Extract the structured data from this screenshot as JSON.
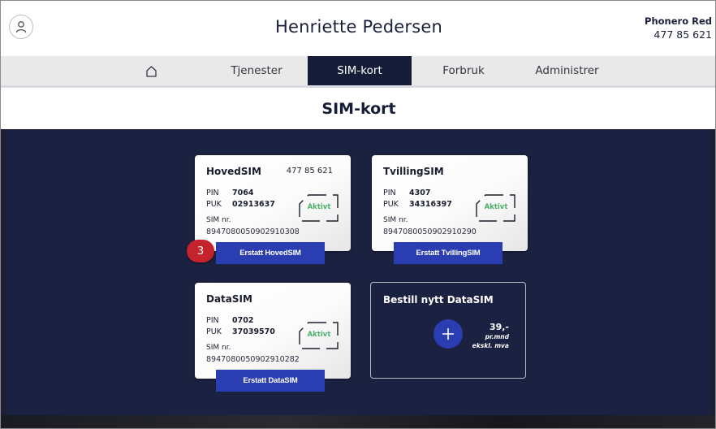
{
  "header": {
    "user_name": "Henriette Pedersen",
    "provider": "Phonero Red",
    "phone_number": "477 85 621",
    "avatar_icon": "user-icon"
  },
  "nav": {
    "home_icon": "home-icon",
    "items": [
      {
        "label": "Tjenester"
      },
      {
        "label": "SIM-kort",
        "active": true
      },
      {
        "label": "Forbruk"
      },
      {
        "label": "Administrer"
      }
    ]
  },
  "section_title": "SIM-kort",
  "cards": [
    {
      "title": "HovedSIM",
      "msisdn": "477 85 621",
      "pin_label": "PIN",
      "pin": "7064",
      "puk_label": "PUK",
      "puk": "02913637",
      "sim_label": "SIM nr.",
      "sim_number": "8947080050902910308",
      "status": "Aktivt",
      "button": "Erstatt HovedSIM"
    },
    {
      "title": "TvillingSIM",
      "pin_label": "PIN",
      "pin": "4307",
      "puk_label": "PUK",
      "puk": "34316397",
      "sim_label": "SIM nr.",
      "sim_number": "8947080050902910290",
      "status": "Aktivt",
      "button": "Erstatt TvillingSIM"
    },
    {
      "title": "DataSIM",
      "pin_label": "PIN",
      "pin": "0702",
      "puk_label": "PUK",
      "puk": "37039570",
      "sim_label": "SIM nr.",
      "sim_number": "8947080050902910282",
      "status": "Aktivt",
      "button": "Erstatt DataSIM"
    }
  ],
  "order_card": {
    "title": "Bestill nytt DataSIM",
    "price": "39,-",
    "price_unit": "pr.mnd",
    "price_tax": "ekskl. mva",
    "plus_icon": "plus-icon"
  },
  "step_badge": "3",
  "colors": {
    "brand_dark": "#151c38",
    "button_blue": "#2a3db1",
    "active_green": "#4caf6a",
    "badge_red": "#c4222d"
  }
}
